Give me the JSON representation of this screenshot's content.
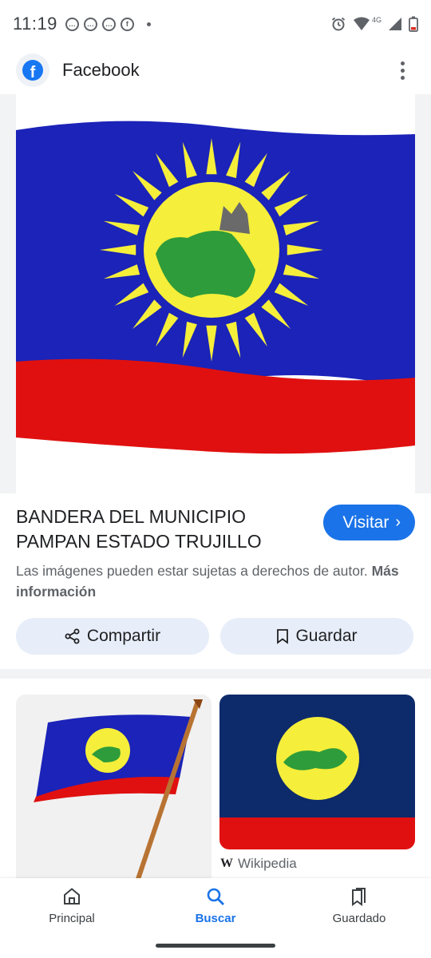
{
  "status_bar": {
    "time": "11:19",
    "network": "4G",
    "notification_icons": [
      "chat-icon",
      "chat-icon",
      "chat-icon",
      "facebook-icon"
    ],
    "system_icons": [
      "alarm-icon",
      "wifi-icon",
      "signal-icon",
      "battery-icon"
    ]
  },
  "header": {
    "site_name": "Facebook",
    "logo_icon": "facebook-icon",
    "more_icon": "more-vert-icon"
  },
  "result": {
    "title": "BANDERA DEL MUNICIPIO PAMPAN ESTADO TRUJILLO",
    "visit_label": "Visitar",
    "copyright_text": "Las imágenes pueden estar sujetas a derechos de autor.",
    "more_info_label": "Más información"
  },
  "actions": {
    "share_label": "Compartir",
    "share_icon": "share-icon",
    "save_label": "Guardar",
    "save_icon": "bookmark-icon"
  },
  "related": {
    "second_source": "Wikipedia"
  },
  "colors": {
    "flag_blue": "#1b23b8",
    "flag_red": "#e01010",
    "sun_yellow": "#f5ee3a",
    "map_green": "#2e9c3a",
    "accent": "#1a73e8"
  },
  "bottom_nav": {
    "items": [
      {
        "label": "Principal",
        "icon": "home-icon"
      },
      {
        "label": "Buscar",
        "icon": "search-icon",
        "active": true
      },
      {
        "label": "Guardado",
        "icon": "saved-icon"
      }
    ]
  }
}
